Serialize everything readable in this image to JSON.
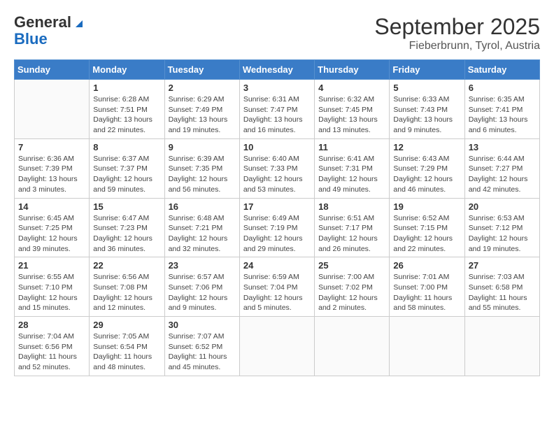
{
  "header": {
    "logo_general": "General",
    "logo_blue": "Blue",
    "title": "September 2025",
    "subtitle": "Fieberbrunn, Tyrol, Austria"
  },
  "days_of_week": [
    "Sunday",
    "Monday",
    "Tuesday",
    "Wednesday",
    "Thursday",
    "Friday",
    "Saturday"
  ],
  "weeks": [
    [
      {
        "day": "",
        "info": ""
      },
      {
        "day": "1",
        "info": "Sunrise: 6:28 AM\nSunset: 7:51 PM\nDaylight: 13 hours\nand 22 minutes."
      },
      {
        "day": "2",
        "info": "Sunrise: 6:29 AM\nSunset: 7:49 PM\nDaylight: 13 hours\nand 19 minutes."
      },
      {
        "day": "3",
        "info": "Sunrise: 6:31 AM\nSunset: 7:47 PM\nDaylight: 13 hours\nand 16 minutes."
      },
      {
        "day": "4",
        "info": "Sunrise: 6:32 AM\nSunset: 7:45 PM\nDaylight: 13 hours\nand 13 minutes."
      },
      {
        "day": "5",
        "info": "Sunrise: 6:33 AM\nSunset: 7:43 PM\nDaylight: 13 hours\nand 9 minutes."
      },
      {
        "day": "6",
        "info": "Sunrise: 6:35 AM\nSunset: 7:41 PM\nDaylight: 13 hours\nand 6 minutes."
      }
    ],
    [
      {
        "day": "7",
        "info": "Sunrise: 6:36 AM\nSunset: 7:39 PM\nDaylight: 13 hours\nand 3 minutes."
      },
      {
        "day": "8",
        "info": "Sunrise: 6:37 AM\nSunset: 7:37 PM\nDaylight: 12 hours\nand 59 minutes."
      },
      {
        "day": "9",
        "info": "Sunrise: 6:39 AM\nSunset: 7:35 PM\nDaylight: 12 hours\nand 56 minutes."
      },
      {
        "day": "10",
        "info": "Sunrise: 6:40 AM\nSunset: 7:33 PM\nDaylight: 12 hours\nand 53 minutes."
      },
      {
        "day": "11",
        "info": "Sunrise: 6:41 AM\nSunset: 7:31 PM\nDaylight: 12 hours\nand 49 minutes."
      },
      {
        "day": "12",
        "info": "Sunrise: 6:43 AM\nSunset: 7:29 PM\nDaylight: 12 hours\nand 46 minutes."
      },
      {
        "day": "13",
        "info": "Sunrise: 6:44 AM\nSunset: 7:27 PM\nDaylight: 12 hours\nand 42 minutes."
      }
    ],
    [
      {
        "day": "14",
        "info": "Sunrise: 6:45 AM\nSunset: 7:25 PM\nDaylight: 12 hours\nand 39 minutes."
      },
      {
        "day": "15",
        "info": "Sunrise: 6:47 AM\nSunset: 7:23 PM\nDaylight: 12 hours\nand 36 minutes."
      },
      {
        "day": "16",
        "info": "Sunrise: 6:48 AM\nSunset: 7:21 PM\nDaylight: 12 hours\nand 32 minutes."
      },
      {
        "day": "17",
        "info": "Sunrise: 6:49 AM\nSunset: 7:19 PM\nDaylight: 12 hours\nand 29 minutes."
      },
      {
        "day": "18",
        "info": "Sunrise: 6:51 AM\nSunset: 7:17 PM\nDaylight: 12 hours\nand 26 minutes."
      },
      {
        "day": "19",
        "info": "Sunrise: 6:52 AM\nSunset: 7:15 PM\nDaylight: 12 hours\nand 22 minutes."
      },
      {
        "day": "20",
        "info": "Sunrise: 6:53 AM\nSunset: 7:12 PM\nDaylight: 12 hours\nand 19 minutes."
      }
    ],
    [
      {
        "day": "21",
        "info": "Sunrise: 6:55 AM\nSunset: 7:10 PM\nDaylight: 12 hours\nand 15 minutes."
      },
      {
        "day": "22",
        "info": "Sunrise: 6:56 AM\nSunset: 7:08 PM\nDaylight: 12 hours\nand 12 minutes."
      },
      {
        "day": "23",
        "info": "Sunrise: 6:57 AM\nSunset: 7:06 PM\nDaylight: 12 hours\nand 9 minutes."
      },
      {
        "day": "24",
        "info": "Sunrise: 6:59 AM\nSunset: 7:04 PM\nDaylight: 12 hours\nand 5 minutes."
      },
      {
        "day": "25",
        "info": "Sunrise: 7:00 AM\nSunset: 7:02 PM\nDaylight: 12 hours\nand 2 minutes."
      },
      {
        "day": "26",
        "info": "Sunrise: 7:01 AM\nSunset: 7:00 PM\nDaylight: 11 hours\nand 58 minutes."
      },
      {
        "day": "27",
        "info": "Sunrise: 7:03 AM\nSunset: 6:58 PM\nDaylight: 11 hours\nand 55 minutes."
      }
    ],
    [
      {
        "day": "28",
        "info": "Sunrise: 7:04 AM\nSunset: 6:56 PM\nDaylight: 11 hours\nand 52 minutes."
      },
      {
        "day": "29",
        "info": "Sunrise: 7:05 AM\nSunset: 6:54 PM\nDaylight: 11 hours\nand 48 minutes."
      },
      {
        "day": "30",
        "info": "Sunrise: 7:07 AM\nSunset: 6:52 PM\nDaylight: 11 hours\nand 45 minutes."
      },
      {
        "day": "",
        "info": ""
      },
      {
        "day": "",
        "info": ""
      },
      {
        "day": "",
        "info": ""
      },
      {
        "day": "",
        "info": ""
      }
    ]
  ]
}
